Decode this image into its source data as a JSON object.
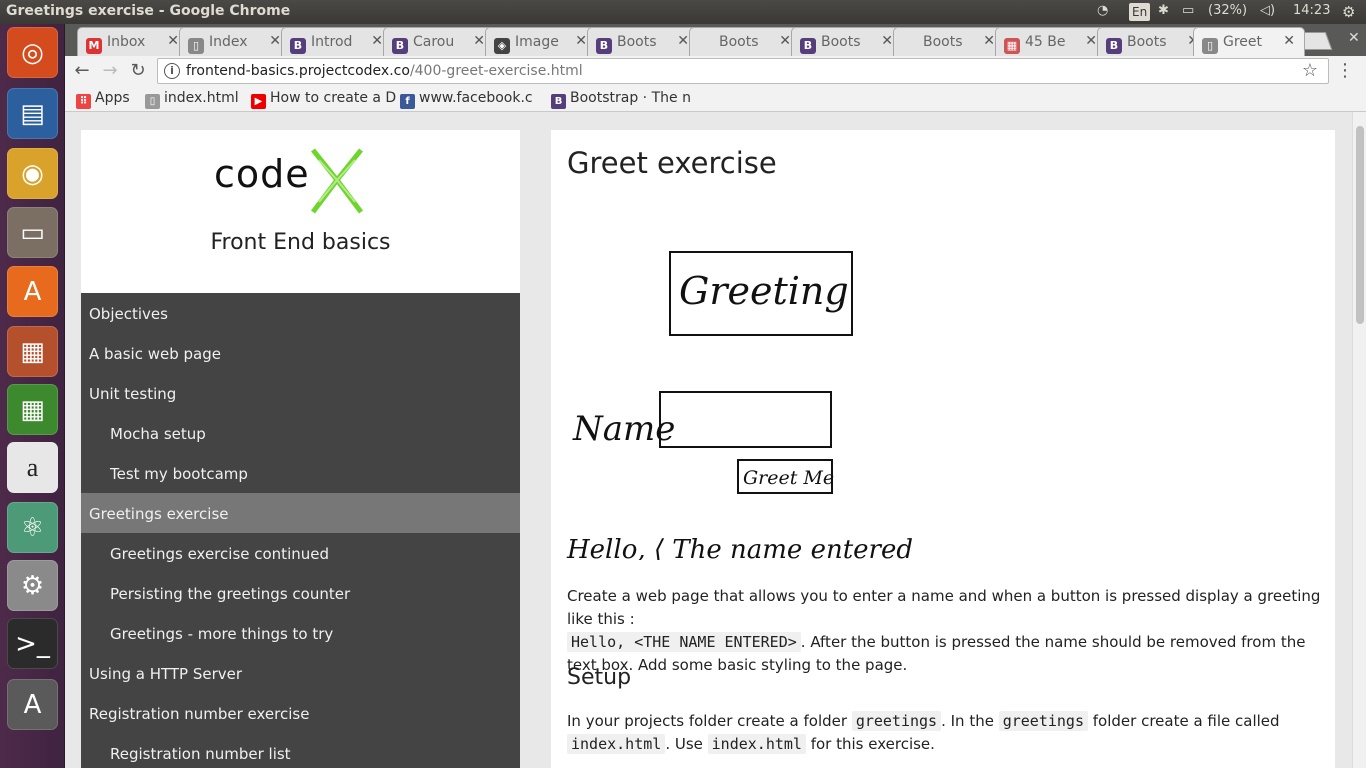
{
  "window": {
    "title": "Greetings exercise - Google Chrome"
  },
  "tray": {
    "lang": "En",
    "battery": "(32%)",
    "time": "14:23"
  },
  "launcher": [
    {
      "name": "ubuntu-dash-icon",
      "glyph": "◎",
      "color": "#d44c1d"
    },
    {
      "name": "libreoffice-writer-icon",
      "glyph": "▤",
      "color": "#2c5f9e"
    },
    {
      "name": "chrome-icon",
      "glyph": "◉",
      "color": "#d9a22a"
    },
    {
      "name": "files-icon",
      "glyph": "▭",
      "color": "#7a6f62"
    },
    {
      "name": "software-center-icon",
      "glyph": "A",
      "color": "#e86a1d"
    },
    {
      "name": "libreoffice-impress-icon",
      "glyph": "▦",
      "color": "#b5502c"
    },
    {
      "name": "libreoffice-calc-icon",
      "glyph": "▦",
      "color": "#3d8a2e"
    },
    {
      "name": "amazon-icon",
      "glyph": "a",
      "color": "#e7e7e7"
    },
    {
      "name": "atom-icon",
      "glyph": "⚛",
      "color": "#4d9a78"
    },
    {
      "name": "system-settings-icon",
      "glyph": "⚙",
      "color": "#8a8a8a"
    },
    {
      "name": "terminal-icon",
      "glyph": ">_",
      "color": "#2b2b2b"
    },
    {
      "name": "software-updater-icon",
      "glyph": "A",
      "color": "#5a5a5a"
    }
  ],
  "tabs": [
    {
      "label": "Inbox",
      "fav": "M",
      "favColor": "#d33"
    },
    {
      "label": "Index",
      "fav": "▯",
      "favColor": "#888"
    },
    {
      "label": "Introd",
      "fav": "B",
      "favColor": "#563d7c"
    },
    {
      "label": "Carou",
      "fav": "B",
      "favColor": "#563d7c"
    },
    {
      "label": "Image",
      "fav": "◈",
      "favColor": "#444"
    },
    {
      "label": "Boots",
      "fav": "B",
      "favColor": "#563d7c"
    },
    {
      "label": "Boots",
      "fav": "",
      "favColor": "transparent"
    },
    {
      "label": "Boots",
      "fav": "B",
      "favColor": "#563d7c"
    },
    {
      "label": "Boots",
      "fav": "",
      "favColor": "transparent"
    },
    {
      "label": "45 Be",
      "fav": "▦",
      "favColor": "#c55"
    },
    {
      "label": "Boots",
      "fav": "B",
      "favColor": "#563d7c"
    },
    {
      "label": "Greet",
      "fav": "▯",
      "favColor": "#888"
    }
  ],
  "address": {
    "host": "frontend-basics.projectcodex.co",
    "path": "/400-greet-exercise.html"
  },
  "bookmarks": [
    {
      "label": "Apps",
      "icon": "⠿",
      "color": "#e44"
    },
    {
      "label": "index.html",
      "icon": "▯",
      "color": "#999"
    },
    {
      "label": "How to create a D",
      "icon": "▶",
      "color": "#e00"
    },
    {
      "label": "www.facebook.c",
      "icon": "f",
      "color": "#3b5998"
    },
    {
      "label": "Bootstrap · The n",
      "icon": "B",
      "color": "#563d7c"
    }
  ],
  "site": {
    "logo_word": "code",
    "title": "Front End basics"
  },
  "nav": [
    {
      "label": "Objectives",
      "sub": false,
      "active": false
    },
    {
      "label": "A basic web page",
      "sub": false,
      "active": false
    },
    {
      "label": "Unit testing",
      "sub": false,
      "active": false
    },
    {
      "label": "Mocha setup",
      "sub": true,
      "active": false
    },
    {
      "label": "Test my bootcamp",
      "sub": true,
      "active": false
    },
    {
      "label": "Greetings exercise",
      "sub": false,
      "active": true
    },
    {
      "label": "Greetings exercise continued",
      "sub": true,
      "active": false
    },
    {
      "label": "Persisting the greetings counter",
      "sub": true,
      "active": false
    },
    {
      "label": "Greetings - more things to try",
      "sub": true,
      "active": false
    },
    {
      "label": "Using a HTTP Server",
      "sub": false,
      "active": false
    },
    {
      "label": "Registration number exercise",
      "sub": false,
      "active": false
    },
    {
      "label": "Registration number list",
      "sub": true,
      "active": false
    }
  ],
  "main": {
    "title": "Greet exercise",
    "sketch": {
      "greeting": "Greeting",
      "name_label": "Name",
      "button": "Greet Me",
      "hello": "Hello,  ⟨ The name entered ⟩"
    },
    "para1": {
      "t1": "Create a web page that allows you to enter a name and when a button is pressed display a greeting like this :",
      "code1": "Hello, <THE NAME ENTERED>",
      "t2": ". After the button is pressed the name should be removed from the text box. Add some basic styling to the page."
    },
    "setup_heading": "Setup",
    "para2": {
      "t1": "In your projects folder create a folder ",
      "code1": "greetings",
      "t2": ". In the ",
      "code2": "greetings",
      "t3": " folder create a file called ",
      "code3": "index.html",
      "t4": ". Use ",
      "code4": "index.html",
      "t5": " for this exercise."
    }
  }
}
